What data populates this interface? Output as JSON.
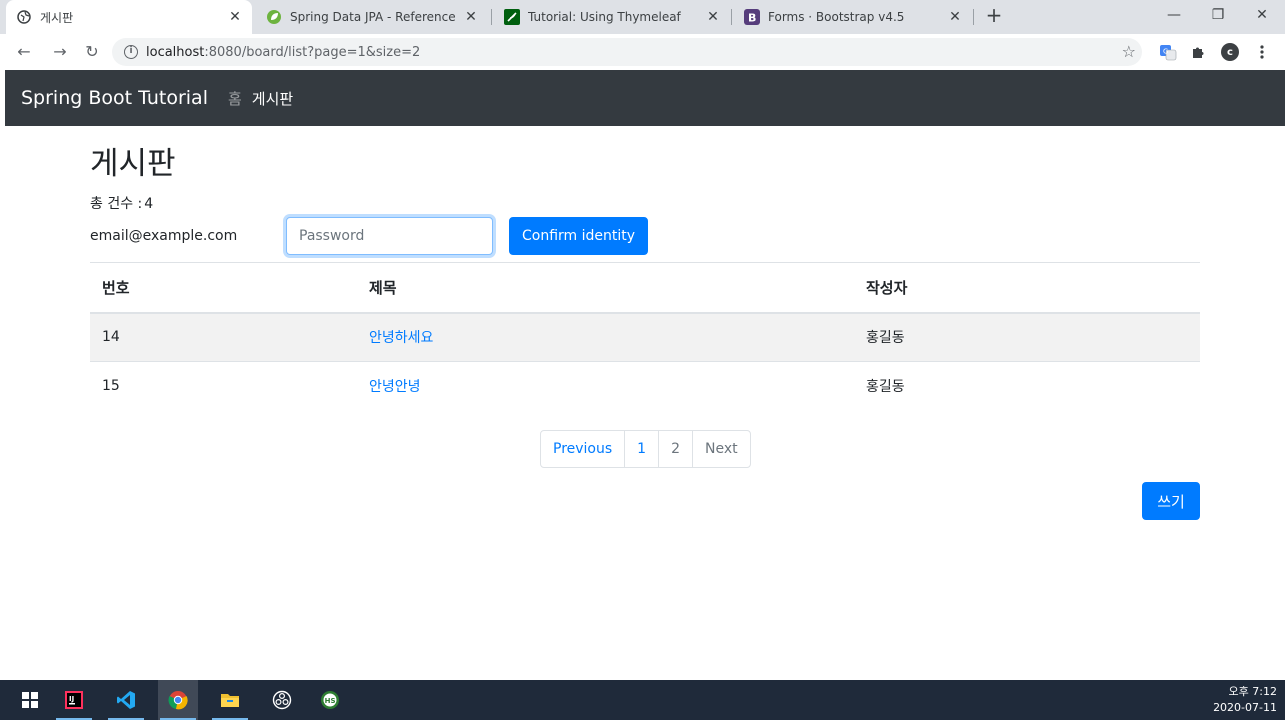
{
  "browser": {
    "tabs": [
      {
        "title": "게시판",
        "icon": "globe-icon"
      },
      {
        "title": "Spring Data JPA - Reference Do",
        "icon": "spring-leaf-icon"
      },
      {
        "title": "Tutorial: Using Thymeleaf",
        "icon": "thymeleaf-icon"
      },
      {
        "title": "Forms · Bootstrap v4.5",
        "icon": "bootstrap-icon"
      }
    ],
    "url_host": "localhost",
    "url_rest": ":8080/board/list?page=1&size=2",
    "profile_initial": "c"
  },
  "navbar": {
    "brand": "Spring Boot Tutorial",
    "links": [
      "홈",
      "게시판"
    ]
  },
  "page": {
    "title": "게시판",
    "total_label": "총 건수 :",
    "total_count": "4",
    "email": "email@example.com",
    "password_placeholder": "Password",
    "confirm_label": "Confirm identity"
  },
  "table": {
    "headers": [
      "번호",
      "제목",
      "작성자"
    ],
    "rows": [
      {
        "id": "14",
        "title": "안녕하세요",
        "author": "홍길동"
      },
      {
        "id": "15",
        "title": "안녕안녕",
        "author": "홍길동"
      }
    ]
  },
  "pagination": {
    "previous": "Previous",
    "pages": [
      "1",
      "2"
    ],
    "next": "Next"
  },
  "write_button": "쓰기",
  "taskbar": {
    "time": "오후 7:12",
    "date": "2020-07-11"
  },
  "colors": {
    "navbar": "#343a40",
    "primary": "#007bff",
    "taskbar": "#1f2a3a"
  }
}
